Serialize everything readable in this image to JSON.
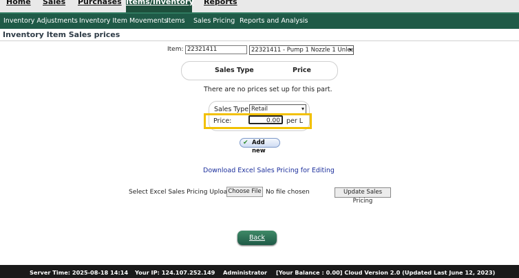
{
  "topnav": {
    "home": "Home",
    "sales": "Sales",
    "purchases": "Purchases",
    "items_inventory": "Items/Inventory",
    "reports": "Reports"
  },
  "subnav": {
    "inventory_adjustments": "Inventory Adjustments",
    "inventory_item_movements": "Inventory Item Movements",
    "items": "Items",
    "sales_pricing": "Sales Pricing",
    "reports_and_analysis": "Reports and Analysis"
  },
  "page": {
    "title": "Inventory Item Sales prices"
  },
  "item": {
    "label": "Item:",
    "code_value": "22321411",
    "selected_option": "22321411 - Pump 1 Nozzle 1 Unlea"
  },
  "prices_table": {
    "headers": [
      "Sales Type",
      "Price"
    ],
    "empty_message": "There are no prices set up for this part."
  },
  "form": {
    "sales_type_label": "Sales Type:",
    "sales_type_value": "Retail",
    "price_label": "Price:",
    "price_value": "0.00",
    "unit": "per L",
    "add_new_label": "Add new"
  },
  "download_link": "Download Excel Sales Pricing for Editing",
  "upload": {
    "label": "Select Excel Sales Pricing Upload:",
    "choose_file": "Choose File",
    "no_file": "No file chosen",
    "update_button": "Update Sales Pricing"
  },
  "back_button": "Back",
  "footer": {
    "server_time": "Server Time: 2025-08-18 14:14",
    "your_ip": "Your IP: 124.107.252.149",
    "user": "Administrator",
    "balance_version": "[Your Balance : 0.00] Cloud Version 2.0 (Updated Last June 12, 2023)"
  },
  "colors": {
    "nav_dark_green": "#1f5a47",
    "highlight_yellow": "#f2c000",
    "footer_bg": "#1a1a1a",
    "link_blue": "#1c2f9c"
  },
  "icons": {
    "add_new": "checkmark-icon",
    "select": "chevron-down-icon"
  }
}
